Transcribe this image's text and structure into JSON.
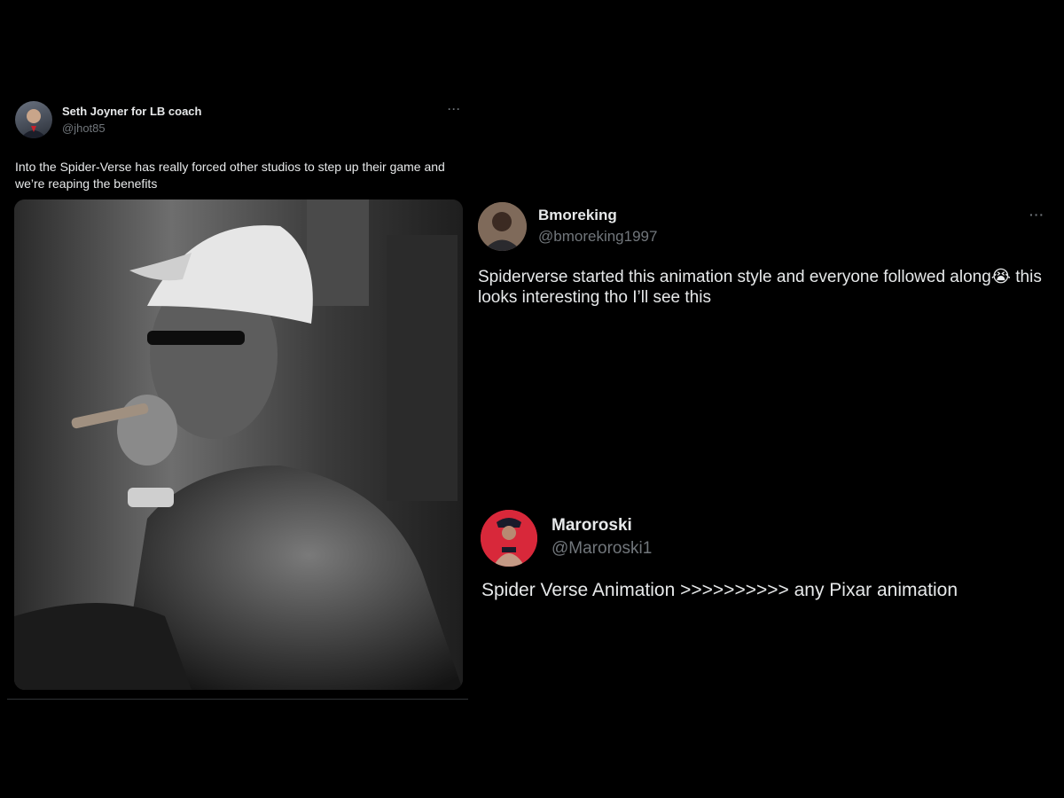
{
  "tweets": [
    {
      "display_name": "Seth Joyner for LB coach",
      "handle": "@jhot85",
      "more_label": "···",
      "text": "Into the Spider-Verse has really forced other studios to step up their game and we’re reaping the benefits",
      "has_media": true
    },
    {
      "display_name": "Bmoreking",
      "handle": "@bmoreking1997",
      "more_label": "···",
      "text": "Spiderverse started this animation style and everyone followed along😭 this looks interesting tho I’ll see this"
    },
    {
      "display_name": "Maroroski",
      "handle": "@Maroroski1",
      "text": "Spider Verse Animation >>>>>>>>>> any Pixar animation"
    }
  ]
}
